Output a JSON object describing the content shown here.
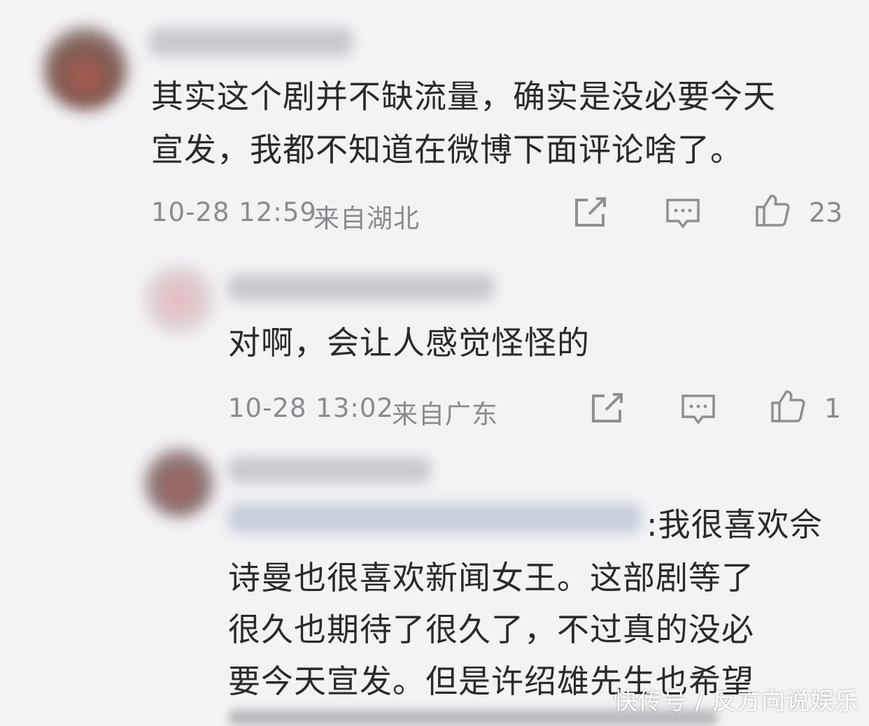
{
  "comments": [
    {
      "lines": [
        "其实这个剧并不缺流量，确实是没必要今天",
        "宣发，我都不知道在微博下面评论啥了。"
      ],
      "timestamp": "10-28 12:59",
      "location": "来自湖北",
      "likes": "23"
    },
    {
      "lines": [
        "对啊，会让人感觉怪怪的"
      ],
      "timestamp": "10-28 13:02",
      "location": "来自广东",
      "likes": "1"
    },
    {
      "reply_suffix": ":我很喜欢佘",
      "lines": [
        "诗曼也很喜欢新闻女王。这部剧等了",
        "很久也期待了很久了，不过真的没必",
        "要今天宣发。但是许绍雄先生也希望"
      ]
    }
  ],
  "watermark": "快传号 / 反方向说娱乐",
  "icons": {
    "share": "share-edit-icon",
    "comment": "comment-bubble-icon",
    "like": "thumbs-up-icon"
  },
  "colors": {
    "background": "#f3f2f5",
    "text": "#2a2a2a",
    "meta": "#8a8a8f"
  }
}
